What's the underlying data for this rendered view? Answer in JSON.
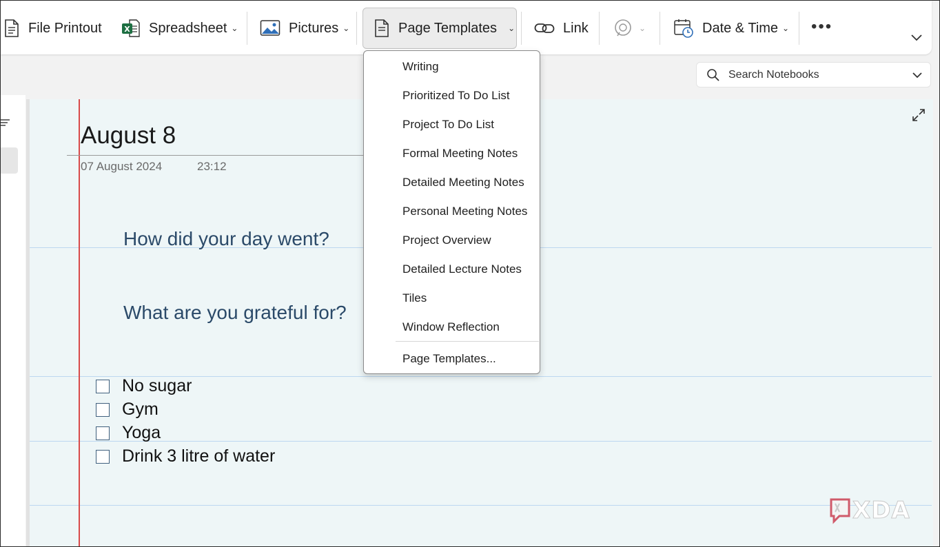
{
  "ribbon": {
    "file_printout": "File Printout",
    "spreadsheet": "Spreadsheet",
    "pictures": "Pictures",
    "page_templates": "Page Templates",
    "link": "Link",
    "date_time": "Date & Time",
    "more": "•••"
  },
  "search": {
    "placeholder": "Search Notebooks"
  },
  "page": {
    "title": "August 8",
    "date": "07 August 2024",
    "time": "23:12",
    "questions": [
      "How did your day went?",
      "What are you grateful for?"
    ],
    "todos": [
      "No sugar",
      "Gym",
      "Yoga",
      "Drink 3 litre of water"
    ]
  },
  "dropdown": {
    "items": [
      "Writing",
      "Prioritized To Do List",
      "Project To Do List",
      "Formal Meeting Notes",
      "Detailed Meeting Notes",
      "Personal Meeting Notes",
      "Project Overview",
      "Detailed Lecture Notes",
      "Tiles",
      "Window Reflection"
    ],
    "footer": "Page Templates..."
  },
  "watermark": {
    "brand": "XDA"
  },
  "colors": {
    "accent_excel": "#1d6f42",
    "picture_icon": "#2f6fb8",
    "margin_line": "#d84a4a",
    "rule_lines": "#bcd7f0",
    "question_text": "#2b4a69"
  }
}
